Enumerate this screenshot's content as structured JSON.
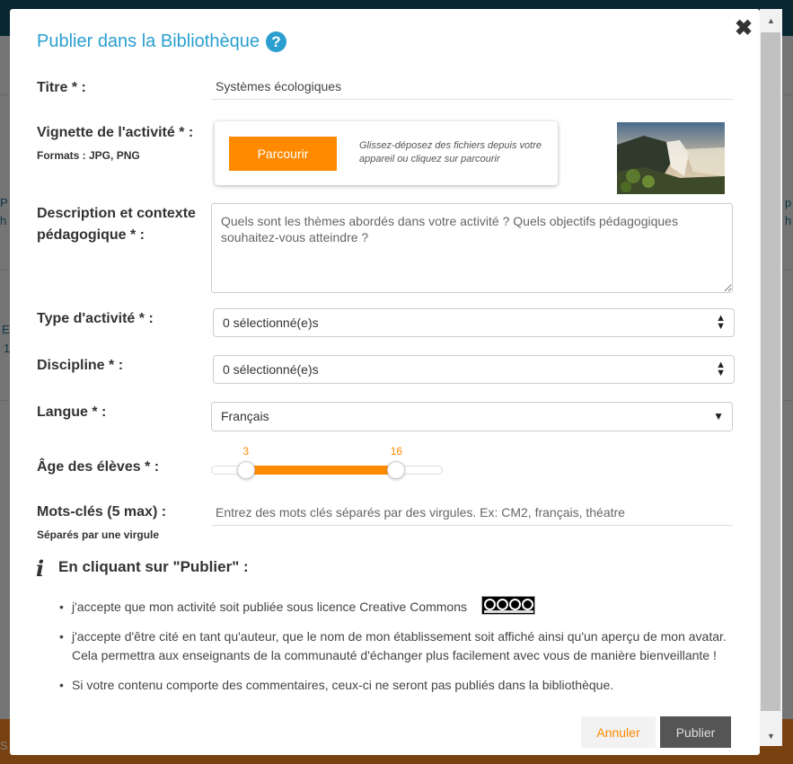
{
  "background": {
    "left_fragments": [
      "P",
      "h",
      "E",
      "1"
    ],
    "right_fragments": [
      "p",
      "h"
    ],
    "bottom_text": "S"
  },
  "modal": {
    "title": "Publier dans la Bibliothèque",
    "help_icon": "?",
    "close_icon": "✖"
  },
  "form": {
    "title_label": "Titre * :",
    "title_value": "Systèmes écologiques",
    "thumbnail_label": "Vignette de l'activité * :",
    "thumbnail_formats": "Formats : JPG, PNG",
    "browse_label": "Parcourir",
    "upload_hint": "Glissez-déposez des fichiers depuis votre appareil ou cliquez sur parcourir",
    "description_label_line1": "Description et contexte",
    "description_label_line2": "pédagogique * :",
    "description_placeholder": "Quels sont les thèmes abordés dans votre activité ? Quels objectifs pédagogiques souhaitez-vous atteindre ?",
    "activity_type_label": "Type d'activité * :",
    "activity_type_value": "0 sélectionné(e)s",
    "discipline_label": "Discipline * :",
    "discipline_value": "0 sélectionné(e)s",
    "language_label": "Langue * :",
    "language_value": "Français",
    "age_label": "Âge des élèves * :",
    "age_min": 3,
    "age_max": 16,
    "age_min_text": "3",
    "age_max_text": "16",
    "keywords_label": "Mots-clés (5 max) :",
    "keywords_sublabel": "Séparés par une virgule",
    "keywords_placeholder": "Entrez des mots clés séparés par des virgules. Ex: CM2, français, théatre"
  },
  "terms": {
    "info_icon": "i",
    "title": "En cliquant sur \"Publier\" :",
    "items": [
      "j'accepte que mon activité soit publiée sous licence Creative Commons",
      "j'accepte d'être cité en tant qu'auteur, que le nom de mon établissement soit affiché ainsi qu'un aperçu de mon avatar. Cela permettra aux enseignants de la communauté d'échanger plus facilement avec vous de manière bienveillante !",
      "Si votre contenu comporte des commentaires, ceux-ci ne seront pas publiés dans la bibliothèque."
    ],
    "license_badge": "cc-by-nc-sa-badge"
  },
  "actions": {
    "cancel_label": "Annuler",
    "publish_label": "Publier"
  },
  "colors": {
    "accent": "#ff8a00",
    "title_blue": "#2a9fd0",
    "publish_bg": "#555555"
  }
}
